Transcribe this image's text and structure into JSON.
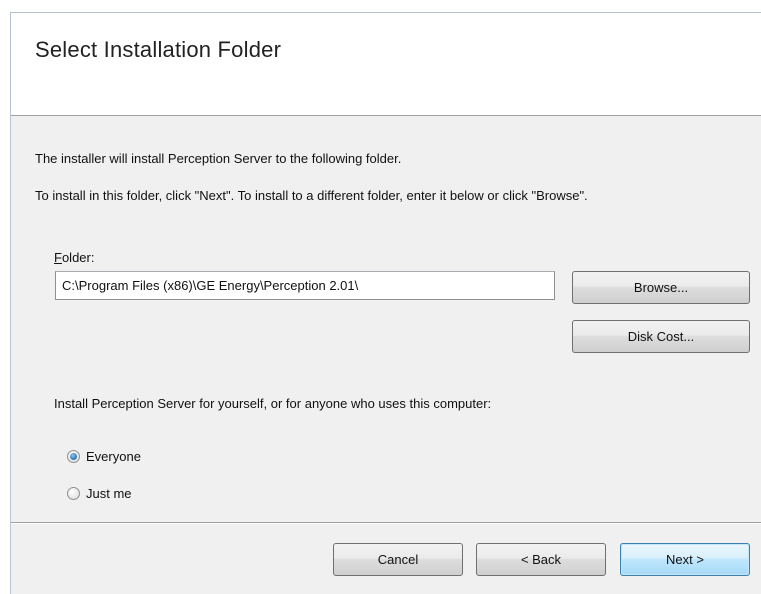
{
  "dialog": {
    "title": "Select Installation Folder",
    "intro_text": "The installer will install Perception Server to the following folder.",
    "instruction_text": "To install in this folder, click \"Next\". To install to a different folder, enter it below or click \"Browse\".",
    "folder_label_accel": "F",
    "folder_label_rest": "older:",
    "folder_value": "C:\\Program Files (x86)\\GE Energy\\Perception 2.01\\",
    "browse_label": "Browse...",
    "disk_cost_label": "Disk Cost...",
    "install_for_text": "Install Perception Server for yourself, or for anyone who uses this computer:",
    "options": [
      {
        "label": "Everyone",
        "selected": true
      },
      {
        "label": "Just me",
        "selected": false
      }
    ]
  },
  "footer": {
    "cancel_label": "Cancel",
    "back_label": "< Back",
    "next_label": "Next >"
  },
  "colors": {
    "banner_bg": "#ffffff",
    "dialog_bg": "#f0f0f0",
    "default_button_border": "#3c7fb1",
    "radio_selected": "#2a6fb0"
  }
}
